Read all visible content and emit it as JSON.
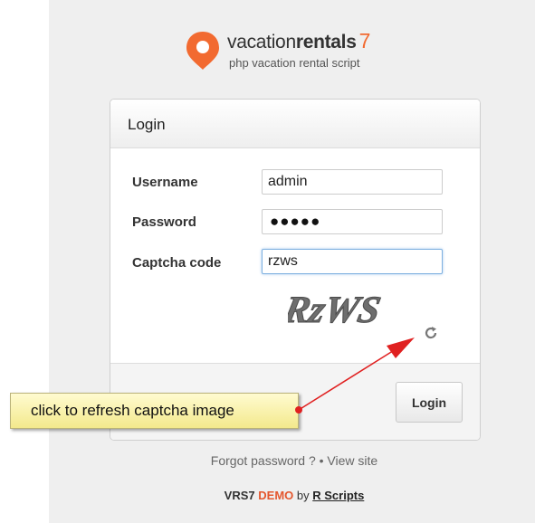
{
  "brand": {
    "name_light": "vacation",
    "name_bold": "rentals",
    "version": "7",
    "tagline": "php vacation rental script",
    "accent_color": "#f26a30",
    "icon": "map-pin-icon"
  },
  "login_card": {
    "title": "Login",
    "fields": {
      "username": {
        "label": "Username",
        "value": "admin"
      },
      "password": {
        "label": "Password",
        "masked_value": "●●●●●"
      },
      "captcha": {
        "label": "Captcha code",
        "value": "rzws"
      }
    },
    "captcha_image_text": "RzWS",
    "refresh_icon": "refresh-icon",
    "submit_label": "Login"
  },
  "annotation": {
    "text": "click to refresh captcha image",
    "arrow_color": "#e02020"
  },
  "links": {
    "forgot_password": "Forgot password ?",
    "separator": "•",
    "view_site": "View site"
  },
  "credit": {
    "product": "VRS7",
    "demo": "DEMO",
    "by": "by",
    "author": "R Scripts"
  }
}
